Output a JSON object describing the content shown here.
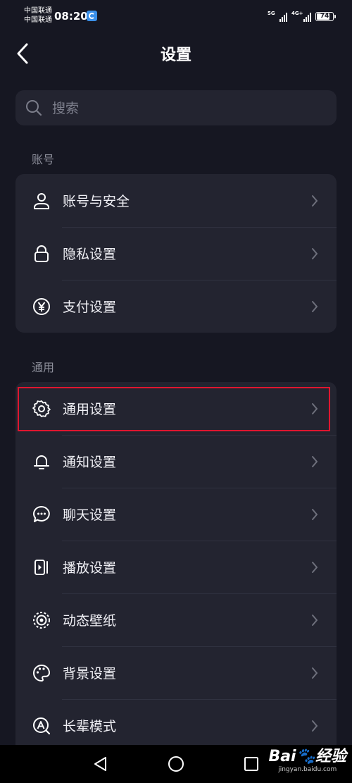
{
  "status_bar": {
    "carrier1": "中国联通",
    "carrier2": "中国联通",
    "time": "08:20",
    "network1": "5G",
    "network2": "4G+",
    "battery": "74"
  },
  "header": {
    "title": "设置"
  },
  "search": {
    "placeholder": "搜索"
  },
  "sections": [
    {
      "label": "账号",
      "items": [
        {
          "label": "账号与安全",
          "icon": "person-icon"
        },
        {
          "label": "隐私设置",
          "icon": "lock-icon"
        },
        {
          "label": "支付设置",
          "icon": "yuan-icon"
        }
      ]
    },
    {
      "label": "通用",
      "items": [
        {
          "label": "通用设置",
          "icon": "gear-icon"
        },
        {
          "label": "通知设置",
          "icon": "bell-icon"
        },
        {
          "label": "聊天设置",
          "icon": "chat-icon"
        },
        {
          "label": "播放设置",
          "icon": "play-icon"
        },
        {
          "label": "动态壁纸",
          "icon": "wallpaper-icon"
        },
        {
          "label": "背景设置",
          "icon": "palette-icon"
        },
        {
          "label": "长辈模式",
          "icon": "elder-mode-icon"
        }
      ]
    }
  ],
  "highlight_color": "#e0162f",
  "watermark": {
    "main": "Bai🐾经验",
    "sub": "jingyan.baidu.com"
  }
}
